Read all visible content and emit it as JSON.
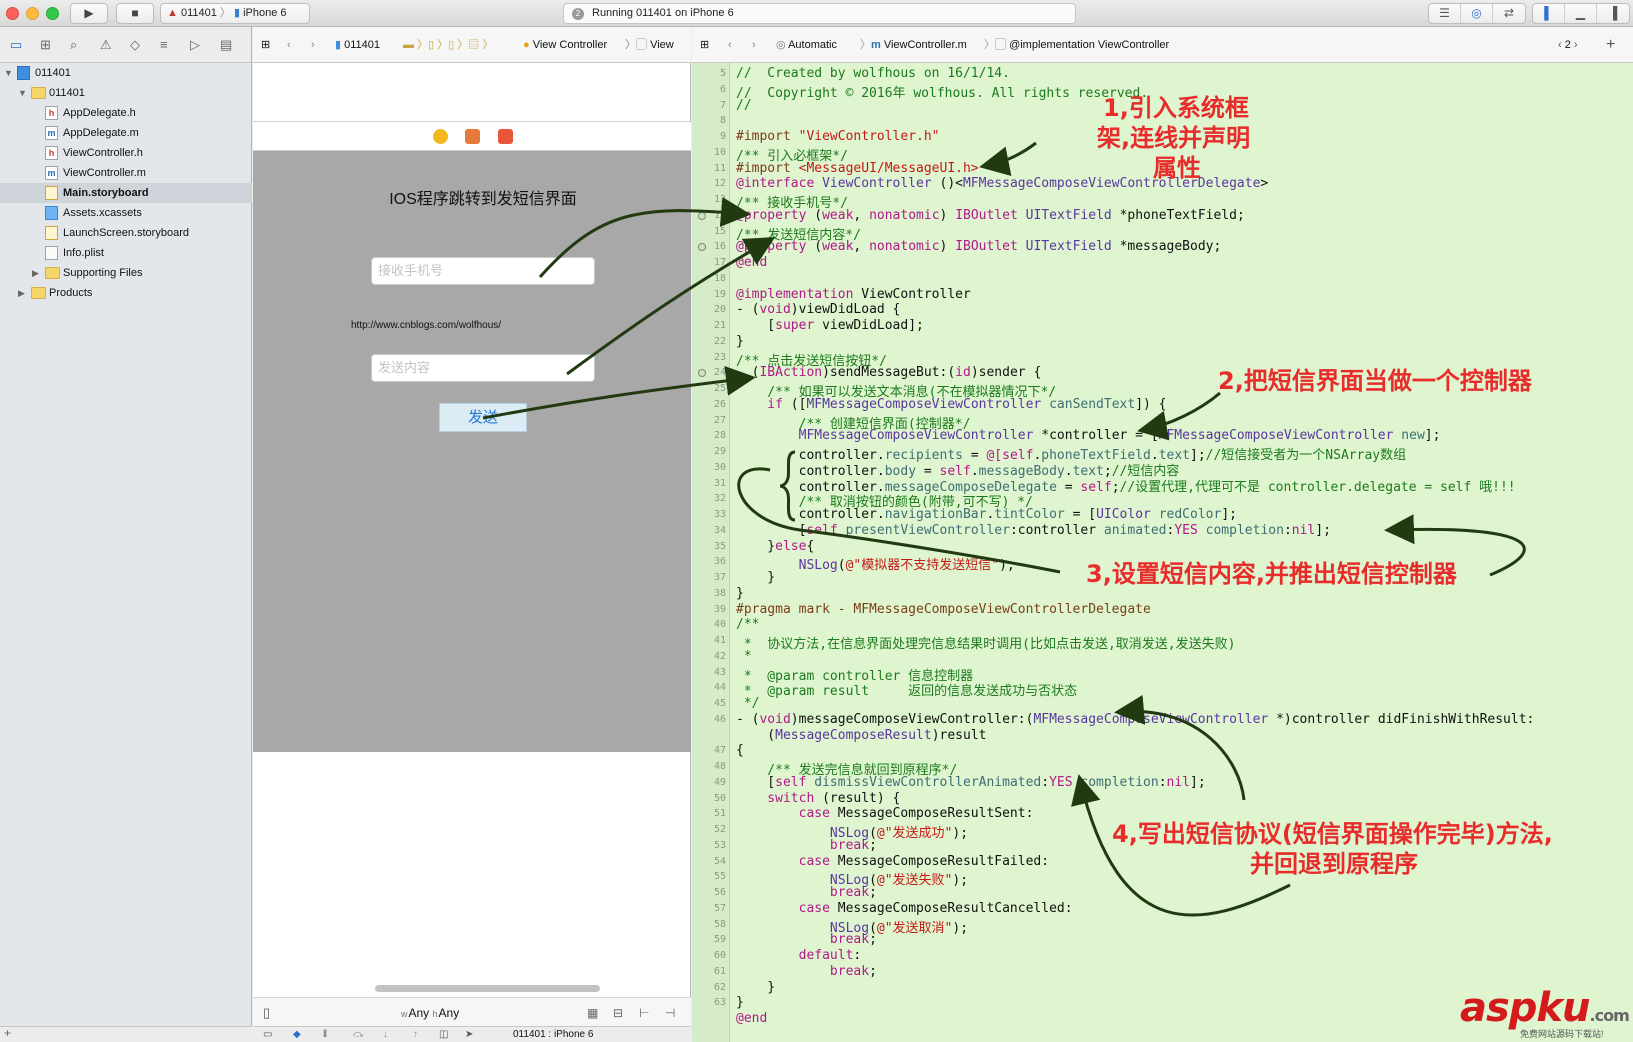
{
  "toolbar": {
    "scheme_project": "011401",
    "scheme_device": "iPhone 6",
    "status_badge": "2",
    "status_text": "Running 011401 on iPhone 6",
    "play_icon": "play-icon",
    "stop_icon": "stop-icon"
  },
  "navigator": {
    "tabs": [
      "folder-icon",
      "hierarchy-icon",
      "search-icon",
      "warning-icon",
      "test-icon",
      "debug-icon",
      "breakpoint-icon",
      "report-icon"
    ],
    "tree": [
      {
        "label": "011401",
        "icon": "proj",
        "depth": 0,
        "tri": "▼"
      },
      {
        "label": "011401",
        "icon": "folder",
        "depth": 1,
        "tri": "▼"
      },
      {
        "label": "AppDelegate.h",
        "icon": "h",
        "depth": 2,
        "tri": ""
      },
      {
        "label": "AppDelegate.m",
        "icon": "m",
        "depth": 2,
        "tri": ""
      },
      {
        "label": "ViewController.h",
        "icon": "h",
        "depth": 2,
        "tri": ""
      },
      {
        "label": "ViewController.m",
        "icon": "m",
        "depth": 2,
        "tri": ""
      },
      {
        "label": "Main.storyboard",
        "icon": "sb",
        "depth": 2,
        "tri": "",
        "selected": true
      },
      {
        "label": "Assets.xcassets",
        "icon": "assets",
        "depth": 2,
        "tri": ""
      },
      {
        "label": "LaunchScreen.storyboard",
        "icon": "sb",
        "depth": 2,
        "tri": ""
      },
      {
        "label": "Info.plist",
        "icon": "plist",
        "depth": 2,
        "tri": ""
      },
      {
        "label": "Supporting Files",
        "icon": "folder",
        "depth": 2,
        "tri": "▶"
      },
      {
        "label": "Products",
        "icon": "folder",
        "depth": 1,
        "tri": "▶"
      }
    ]
  },
  "ib": {
    "jumpbar": [
      "011401",
      "View Controller",
      "View"
    ],
    "title": "IOS程序跳转到发短信界面",
    "phone_placeholder": "接收手机号",
    "url": "http://www.cnblogs.com/wolfhous/",
    "body_placeholder": "发送内容",
    "send_button": "发送",
    "size_w": "Any",
    "size_h": "Any",
    "size_w_prefix": "w",
    "size_h_prefix": "h",
    "debug_target": "011401 : iPhone 6"
  },
  "editor": {
    "jumpbar": {
      "mode": "Automatic",
      "file": "ViewController.m",
      "symbol": "@implementation ViewController",
      "counter": "2"
    }
  },
  "code_lines": [
    {
      "n": "5",
      "parts": [
        [
          "c",
          "//  Created by wolfhous on 16/1/14."
        ]
      ]
    },
    {
      "n": "6",
      "parts": [
        [
          "c",
          "//  Copyright © 2016年 wolfhous. All rights reserved."
        ]
      ]
    },
    {
      "n": "7",
      "parts": [
        [
          "c",
          "//"
        ]
      ]
    },
    {
      "n": "8",
      "parts": []
    },
    {
      "n": "9",
      "parts": [
        [
          "p",
          "#import "
        ],
        [
          "s",
          "\"ViewController.h\""
        ]
      ]
    },
    {
      "n": "10",
      "parts": [
        [
          "c",
          "/** 引入必框架*/"
        ]
      ]
    },
    {
      "n": "11",
      "parts": [
        [
          "p",
          "#import "
        ],
        [
          "s",
          "<MessageUI/MessageUI.h>"
        ]
      ]
    },
    {
      "n": "12",
      "parts": [
        [
          "k",
          "@interface "
        ],
        [
          "t",
          "ViewController"
        ],
        [
          "n",
          " ()<"
        ],
        [
          "t",
          "MFMessageComposeViewControllerDelegate"
        ],
        [
          "n",
          ">"
        ]
      ]
    },
    {
      "n": "13",
      "parts": [
        [
          "c",
          "/** 接收手机号*/"
        ]
      ]
    },
    {
      "n": "14",
      "conn": true,
      "parts": [
        [
          "k",
          "@property "
        ],
        [
          "n",
          "("
        ],
        [
          "k",
          "weak"
        ],
        [
          "n",
          ", "
        ],
        [
          "k",
          "nonatomic"
        ],
        [
          "n",
          ") "
        ],
        [
          "k",
          "IBOutlet "
        ],
        [
          "t",
          "UITextField "
        ],
        [
          "n",
          "*phoneTextField;"
        ]
      ]
    },
    {
      "n": "15",
      "parts": [
        [
          "c",
          "/** 发送短信内容*/"
        ]
      ]
    },
    {
      "n": "16",
      "conn": true,
      "parts": [
        [
          "k",
          "@property "
        ],
        [
          "n",
          "("
        ],
        [
          "k",
          "weak"
        ],
        [
          "n",
          ", "
        ],
        [
          "k",
          "nonatomic"
        ],
        [
          "n",
          ") "
        ],
        [
          "k",
          "IBOutlet "
        ],
        [
          "t",
          "UITextField "
        ],
        [
          "n",
          "*messageBody;"
        ]
      ]
    },
    {
      "n": "17",
      "parts": [
        [
          "k",
          "@end"
        ]
      ]
    },
    {
      "n": "18",
      "parts": []
    },
    {
      "n": "19",
      "parts": [
        [
          "k",
          "@implementation "
        ],
        [
          "n",
          "ViewController"
        ]
      ]
    },
    {
      "n": "20",
      "parts": [
        [
          "n",
          "- ("
        ],
        [
          "k",
          "void"
        ],
        [
          "n",
          ")viewDidLoad {"
        ]
      ]
    },
    {
      "n": "21",
      "parts": [
        [
          "n",
          "    ["
        ],
        [
          "k",
          "super "
        ],
        [
          "n",
          "viewDidLoad];"
        ]
      ]
    },
    {
      "n": "22",
      "parts": [
        [
          "n",
          "}"
        ]
      ]
    },
    {
      "n": "23",
      "parts": [
        [
          "c",
          "/** 点击发送短信按钮*/"
        ]
      ]
    },
    {
      "n": "24",
      "conn": true,
      "parts": [
        [
          "n",
          "- ("
        ],
        [
          "k",
          "IBAction"
        ],
        [
          "n",
          ")sendMessageBut:("
        ],
        [
          "k",
          "id"
        ],
        [
          "n",
          ")sender {"
        ]
      ]
    },
    {
      "n": "25",
      "parts": [
        [
          "c",
          "    /** 如果可以发送文本消息(不在模拟器情况下*/"
        ]
      ]
    },
    {
      "n": "26",
      "parts": [
        [
          "k",
          "    if "
        ],
        [
          "n",
          "(["
        ],
        [
          "t",
          "MFMessageComposeViewController "
        ],
        [
          "y",
          "canSendText"
        ],
        [
          "n",
          "]) {"
        ]
      ]
    },
    {
      "n": "27",
      "parts": [
        [
          "c",
          "        /** 创建短信界面(控制器*/"
        ]
      ]
    },
    {
      "n": "28",
      "parts": [
        [
          "t",
          "        MFMessageComposeViewController "
        ],
        [
          "n",
          "*controller = ["
        ],
        [
          "t",
          "MFMessageComposeViewController "
        ],
        [
          "y",
          "new"
        ],
        [
          "n",
          "];"
        ]
      ]
    },
    {
      "n": "29",
      "parts": [
        [
          "n",
          "        controller."
        ],
        [
          "y",
          "recipients"
        ],
        [
          "n",
          " = "
        ],
        [
          "k",
          "@["
        ],
        [
          "k",
          "self"
        ],
        [
          "n",
          "."
        ],
        [
          "y",
          "phoneTextField"
        ],
        [
          "n",
          "."
        ],
        [
          "y",
          "text"
        ],
        [
          "n",
          "];"
        ],
        [
          "c",
          "//短信接受者为一个NSArray数组"
        ]
      ]
    },
    {
      "n": "30",
      "parts": [
        [
          "n",
          "        controller."
        ],
        [
          "y",
          "body"
        ],
        [
          "n",
          " = "
        ],
        [
          "k",
          "self"
        ],
        [
          "n",
          "."
        ],
        [
          "y",
          "messageBody"
        ],
        [
          "n",
          "."
        ],
        [
          "y",
          "text"
        ],
        [
          "n",
          ";"
        ],
        [
          "c",
          "//短信内容"
        ]
      ]
    },
    {
      "n": "31",
      "parts": [
        [
          "n",
          "        controller."
        ],
        [
          "y",
          "messageComposeDelegate"
        ],
        [
          "n",
          " = "
        ],
        [
          "k",
          "self"
        ],
        [
          "n",
          ";"
        ],
        [
          "c",
          "//设置代理,代理可不是 controller.delegate = self 哦!!!"
        ]
      ]
    },
    {
      "n": "32",
      "parts": [
        [
          "c",
          "        /** 取消按钮的颜色(附带,可不写) */"
        ]
      ]
    },
    {
      "n": "33",
      "parts": [
        [
          "n",
          "        controller."
        ],
        [
          "y",
          "navigationBar"
        ],
        [
          "n",
          "."
        ],
        [
          "y",
          "tintColor"
        ],
        [
          "n",
          " = ["
        ],
        [
          "t",
          "UIColor "
        ],
        [
          "y",
          "redColor"
        ],
        [
          "n",
          "];"
        ]
      ]
    },
    {
      "n": "34",
      "parts": [
        [
          "n",
          "        ["
        ],
        [
          "k",
          "self "
        ],
        [
          "y",
          "presentViewController"
        ],
        [
          "n",
          ":controller "
        ],
        [
          "y",
          "animated"
        ],
        [
          "n",
          ":"
        ],
        [
          "k",
          "YES "
        ],
        [
          "y",
          "completion"
        ],
        [
          "n",
          ":"
        ],
        [
          "k",
          "nil"
        ],
        [
          "n",
          "];"
        ]
      ]
    },
    {
      "n": "35",
      "parts": [
        [
          "n",
          "    }"
        ],
        [
          "k",
          "else"
        ],
        [
          "n",
          "{"
        ]
      ]
    },
    {
      "n": "36",
      "parts": [
        [
          "t",
          "        NSLog"
        ],
        [
          "n",
          "("
        ],
        [
          "s",
          "@\"模拟器不支持发送短信\""
        ],
        [
          "n",
          ");"
        ]
      ]
    },
    {
      "n": "37",
      "parts": [
        [
          "n",
          "    }"
        ]
      ]
    },
    {
      "n": "38",
      "parts": [
        [
          "n",
          "}"
        ]
      ]
    },
    {
      "n": "39",
      "parts": [
        [
          "p",
          "#pragma mark - MFMessageComposeViewControllerDelegate"
        ]
      ]
    },
    {
      "n": "40",
      "parts": [
        [
          "c",
          "/**"
        ]
      ]
    },
    {
      "n": "41",
      "parts": [
        [
          "c",
          " *  协议方法,在信息界面处理完信息结果时调用(比如点击发送,取消发送,发送失败)"
        ]
      ]
    },
    {
      "n": "42",
      "parts": [
        [
          "c",
          " *"
        ]
      ]
    },
    {
      "n": "43",
      "parts": [
        [
          "c",
          " *  @param controller 信息控制器"
        ]
      ]
    },
    {
      "n": "44",
      "parts": [
        [
          "c",
          " *  @param result     返回的信息发送成功与否状态"
        ]
      ]
    },
    {
      "n": "45",
      "parts": [
        [
          "c",
          " */"
        ]
      ]
    },
    {
      "n": "46",
      "parts": [
        [
          "n",
          "- ("
        ],
        [
          "k",
          "void"
        ],
        [
          "n",
          ")messageComposeViewController:("
        ],
        [
          "t",
          "MFMessageComposeViewController "
        ],
        [
          "n",
          "*)controller didFinishWithResult:"
        ]
      ]
    },
    {
      "n": "",
      "parts": [
        [
          "n",
          "    ("
        ],
        [
          "t",
          "MessageComposeResult"
        ],
        [
          "n",
          ")result"
        ]
      ]
    },
    {
      "n": "47",
      "parts": [
        [
          "n",
          "{"
        ]
      ]
    },
    {
      "n": "48",
      "parts": [
        [
          "c",
          "    /** 发送完信息就回到原程序*/"
        ]
      ]
    },
    {
      "n": "49",
      "parts": [
        [
          "n",
          "    ["
        ],
        [
          "k",
          "self "
        ],
        [
          "y",
          "dismissViewControllerAnimated"
        ],
        [
          "n",
          ":"
        ],
        [
          "k",
          "YES "
        ],
        [
          "y",
          "completion"
        ],
        [
          "n",
          ":"
        ],
        [
          "k",
          "nil"
        ],
        [
          "n",
          "];"
        ]
      ]
    },
    {
      "n": "50",
      "parts": [
        [
          "k",
          "    switch "
        ],
        [
          "n",
          "(result) {"
        ]
      ]
    },
    {
      "n": "51",
      "parts": [
        [
          "k",
          "        case "
        ],
        [
          "n",
          "MessageComposeResultSent:"
        ]
      ]
    },
    {
      "n": "52",
      "parts": [
        [
          "t",
          "            NSLog"
        ],
        [
          "n",
          "("
        ],
        [
          "s",
          "@\"发送成功\""
        ],
        [
          "n",
          ");"
        ]
      ]
    },
    {
      "n": "53",
      "parts": [
        [
          "k",
          "            break"
        ],
        [
          "n",
          ";"
        ]
      ]
    },
    {
      "n": "54",
      "parts": [
        [
          "k",
          "        case "
        ],
        [
          "n",
          "MessageComposeResultFailed:"
        ]
      ]
    },
    {
      "n": "55",
      "parts": [
        [
          "t",
          "            NSLog"
        ],
        [
          "n",
          "("
        ],
        [
          "s",
          "@\"发送失败\""
        ],
        [
          "n",
          ");"
        ]
      ]
    },
    {
      "n": "56",
      "parts": [
        [
          "k",
          "            break"
        ],
        [
          "n",
          ";"
        ]
      ]
    },
    {
      "n": "57",
      "parts": [
        [
          "k",
          "        case "
        ],
        [
          "n",
          "MessageComposeResultCancelled:"
        ]
      ]
    },
    {
      "n": "58",
      "parts": [
        [
          "t",
          "            NSLog"
        ],
        [
          "n",
          "("
        ],
        [
          "s",
          "@\"发送取消\""
        ],
        [
          "n",
          ");"
        ]
      ]
    },
    {
      "n": "59",
      "parts": [
        [
          "k",
          "            break"
        ],
        [
          "n",
          ";"
        ]
      ]
    },
    {
      "n": "60",
      "parts": [
        [
          "k",
          "        default"
        ],
        [
          "n",
          ":"
        ]
      ]
    },
    {
      "n": "61",
      "parts": [
        [
          "k",
          "            break"
        ],
        [
          "n",
          ";"
        ]
      ]
    },
    {
      "n": "62",
      "parts": [
        [
          "n",
          "    }"
        ]
      ]
    },
    {
      "n": "63",
      "parts": [
        [
          "n",
          "}"
        ]
      ]
    },
    {
      "n": "",
      "parts": [
        [
          "k",
          "@end"
        ]
      ]
    }
  ],
  "annotations": {
    "note1_line1": "1,引入系统框",
    "note1_line2": "架,连线并声明",
    "note1_line3": "属性",
    "note2": "2,把短信界面当做一个控制器",
    "note3": "3,设置短信内容,并推出短信控制器",
    "note4_line1": "4,写出短信协议(短信界面操作完毕)方法,",
    "note4_line2": "并回退到原程序",
    "color": "#e82b2b"
  },
  "watermark": {
    "text": "aspku",
    "suffix": ".com",
    "sub": "免费网站源码下载站!"
  }
}
